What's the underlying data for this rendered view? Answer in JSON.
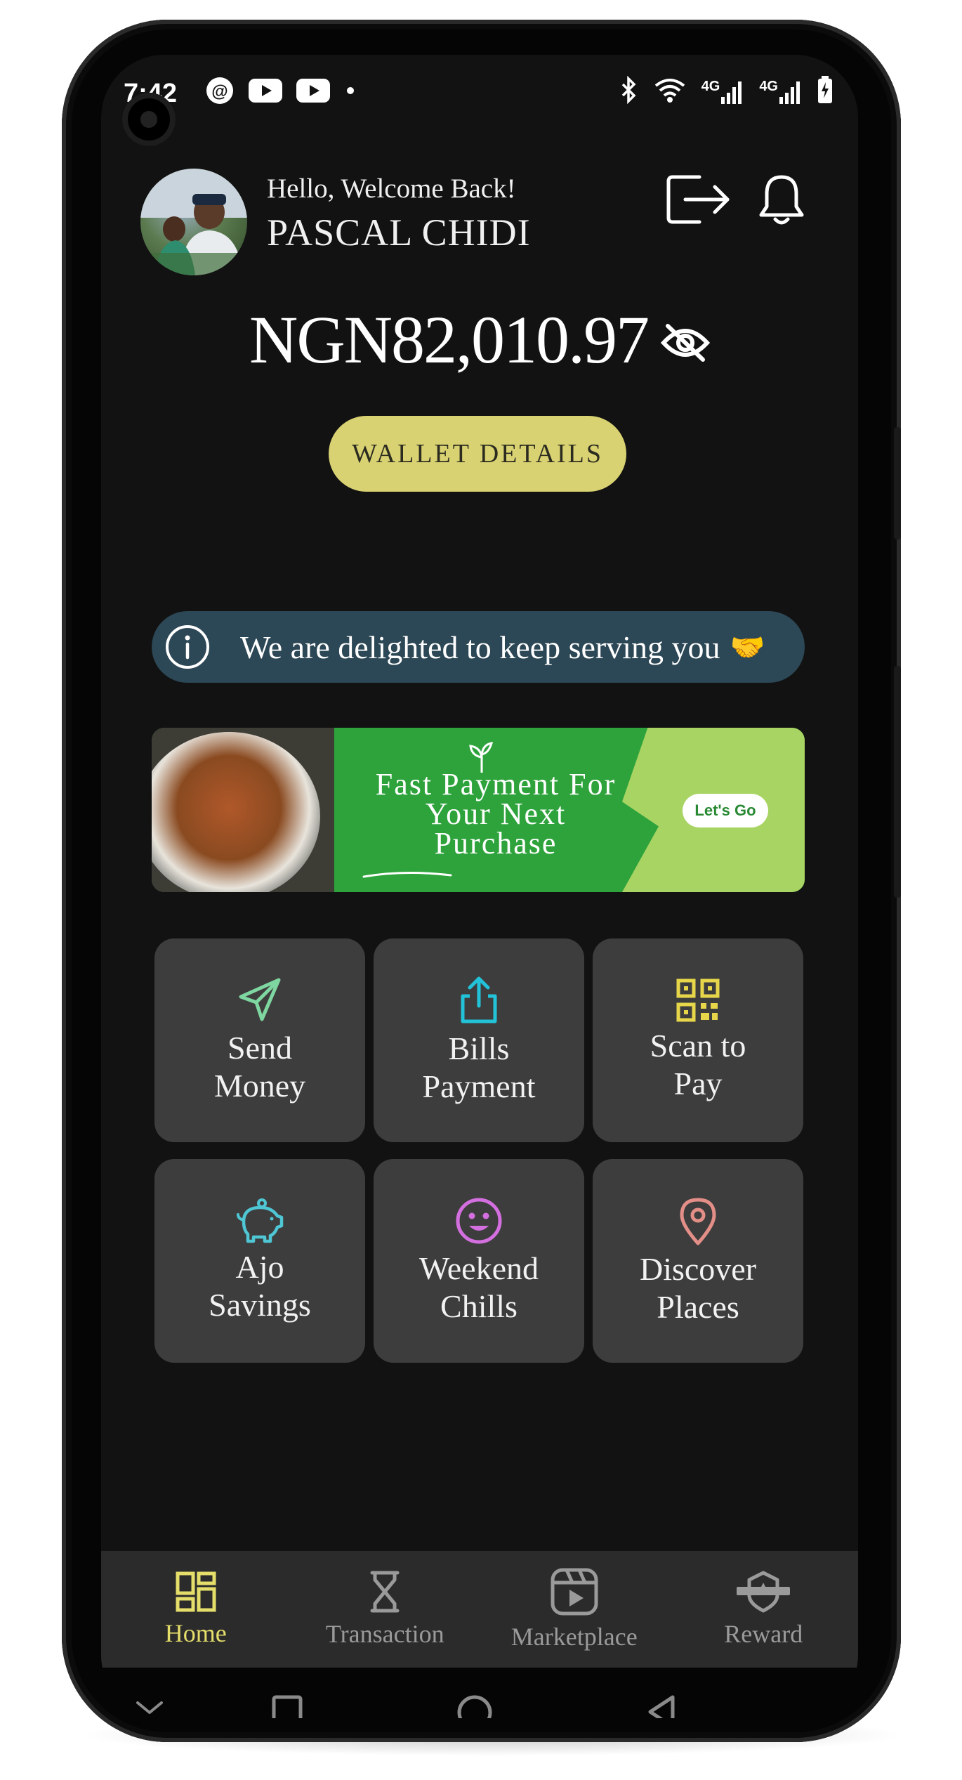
{
  "status_bar": {
    "time": "7:42",
    "left_icons": [
      "threads-icon",
      "youtube-icon",
      "youtube-icon",
      "dot-icon"
    ],
    "right_icons": [
      "bluetooth-icon",
      "wifi-icon",
      "4g-signal-icon",
      "4g-signal-icon",
      "battery-charging-icon"
    ],
    "network_labels": [
      "4G",
      "4G"
    ]
  },
  "header": {
    "greeting": "Hello, Welcome Back!",
    "user_name": "PASCAL CHIDI"
  },
  "balance": {
    "amount": "NGN82,010.97",
    "wallet_button": "WALLET DETAILS"
  },
  "notice": {
    "text": "We are delighted to keep serving you",
    "emoji": "🤝"
  },
  "banner": {
    "title": "Fast Payment For Your Next Purchase",
    "cta": "Let's Go"
  },
  "actions": [
    {
      "label": "Send\nMoney",
      "icon": "send-icon",
      "color": "#7ed6a0"
    },
    {
      "label": "Bills\nPayment",
      "icon": "share-upload-icon",
      "color": "#22c3d9"
    },
    {
      "label": "Scan to\nPay",
      "icon": "qr-code-icon",
      "color": "#e8d64a"
    },
    {
      "label": "Ajo\nSavings",
      "icon": "piggy-bank-icon",
      "color": "#4fc6d4"
    },
    {
      "label": "Weekend\nChills",
      "icon": "smiley-icon",
      "color": "#d46fe0"
    },
    {
      "label": "Discover\nPlaces",
      "icon": "location-pin-icon",
      "color": "#e38f88"
    }
  ],
  "bottom_nav": [
    {
      "label": "Home",
      "icon": "dashboard-icon",
      "active": true
    },
    {
      "label": "Transaction",
      "icon": "hourglass-icon",
      "active": false
    },
    {
      "label": "Marketplace",
      "icon": "video-reel-icon",
      "active": false
    },
    {
      "label": "Reward",
      "icon": "badge-icon",
      "active": false
    }
  ],
  "colors": {
    "accent_yellow": "#d9d272",
    "background": "#121212",
    "tile": "#3d3d3d",
    "notice_bg": "#2c4755",
    "banner_green": "#2ea33c"
  }
}
